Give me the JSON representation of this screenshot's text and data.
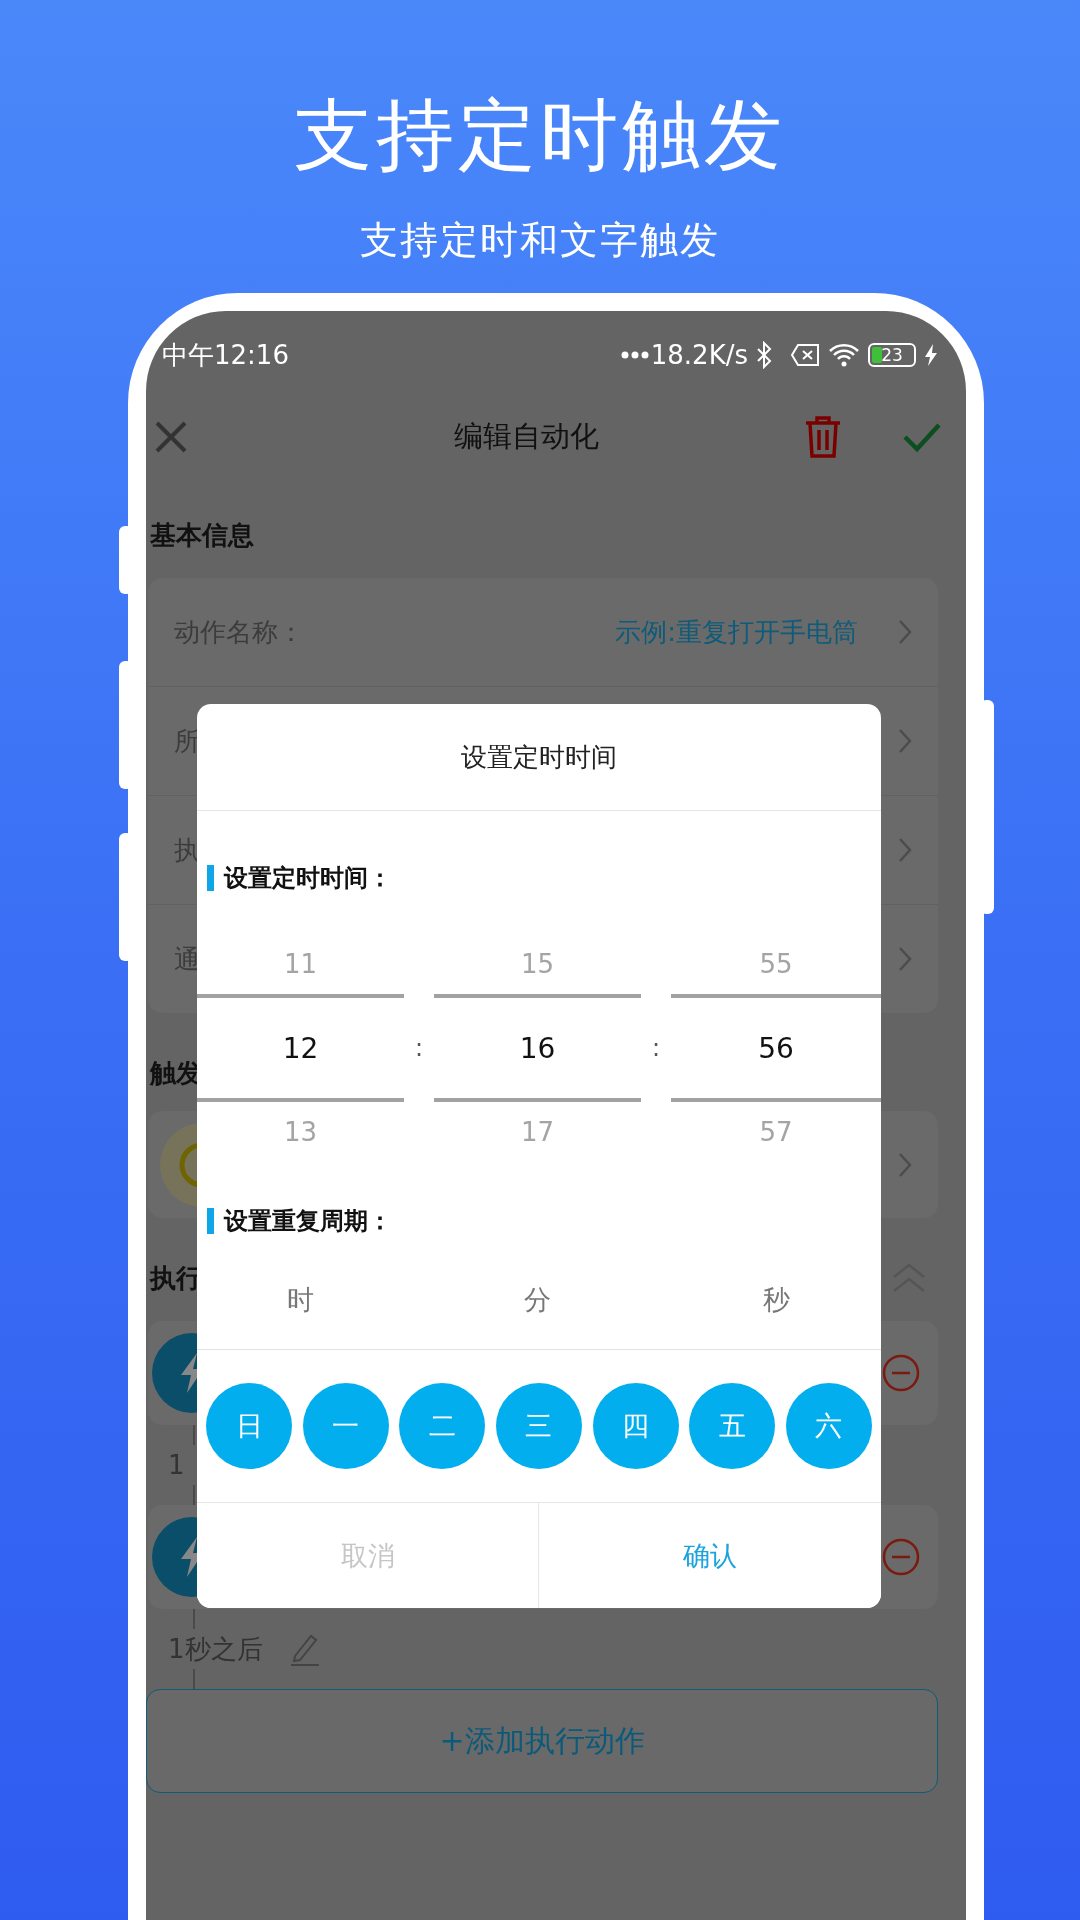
{
  "promo": {
    "title": "支持定时触发",
    "subtitle": "支持定时和文字触发"
  },
  "status_bar": {
    "time": "中午12:16",
    "speed": "18.2K/s",
    "battery": "23"
  },
  "toolbar": {
    "title": "编辑自动化"
  },
  "basic_info": {
    "heading": "基本信息",
    "rows": [
      {
        "label": "动作名称：",
        "value": "示例:重复打开手电筒"
      },
      {
        "label": "所"
      },
      {
        "label": "执"
      },
      {
        "label": "通"
      }
    ]
  },
  "trigger": {
    "heading": "触发"
  },
  "actions": {
    "heading": "执行",
    "items": [
      {
        "delay": "1"
      },
      {
        "delay": "1秒之后"
      }
    ]
  },
  "add_button": "+添加执行动作",
  "dialog": {
    "title": "设置定时时间",
    "time_heading": "设置定时时间：",
    "picker": [
      {
        "above": "11",
        "value": "12",
        "below": "13"
      },
      {
        "above": "15",
        "value": "16",
        "below": "17"
      },
      {
        "above": "55",
        "value": "56",
        "below": "57"
      }
    ],
    "separators": [
      ":",
      ":"
    ],
    "repeat_heading": "设置重复周期：",
    "units": [
      "时",
      "分",
      "秒"
    ],
    "days": [
      {
        "label": "日",
        "selected": true
      },
      {
        "label": "一",
        "selected": true
      },
      {
        "label": "二",
        "selected": true
      },
      {
        "label": "三",
        "selected": true
      },
      {
        "label": "四",
        "selected": true
      },
      {
        "label": "五",
        "selected": true
      },
      {
        "label": "六",
        "selected": true
      }
    ],
    "buttons": [
      {
        "label": "取消",
        "kind": "cancel"
      },
      {
        "label": "确认",
        "kind": "confirm"
      }
    ]
  }
}
